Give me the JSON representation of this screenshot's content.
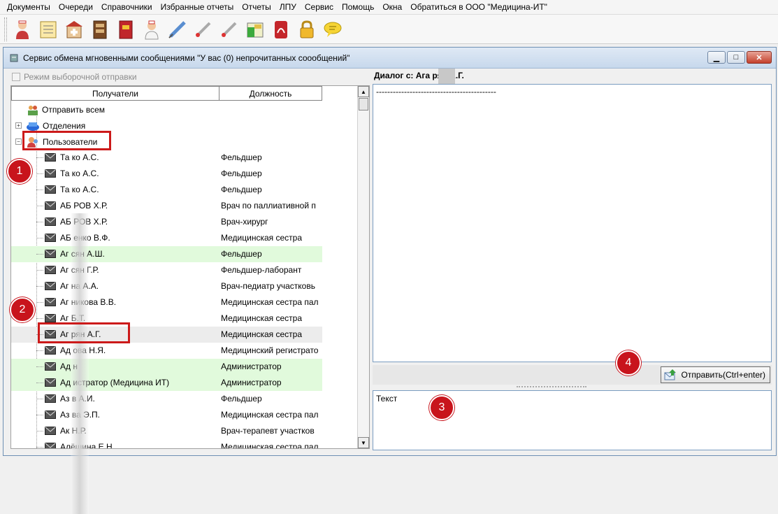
{
  "menu": [
    "Документы",
    "Очереди",
    "Справочники",
    "Избранные отчеты",
    "Отчеты",
    "ЛПУ",
    "Сервис",
    "Помощь",
    "Окна",
    "Обратиться в ООО \"Медицина-ИТ\""
  ],
  "toolbar_icons": [
    "doctor-icon",
    "notepad-icon",
    "hospital-icon",
    "cabinet-icon",
    "red-book-icon",
    "nurse-icon",
    "syringe-icon",
    "thermometer-icon",
    "thermometer2-icon",
    "cash-icon",
    "pdf-icon",
    "lock-icon",
    "chat-icon"
  ],
  "window": {
    "title": "Сервис обмена мгновенными сообщениями \"У вас (0) непрочитанных соообщений\"",
    "btn_min": "▁",
    "btn_max": "□",
    "btn_close": "✕"
  },
  "left": {
    "selective_send_label": "Режим выборочной отправки",
    "col_recipients": "Получатели",
    "col_position": "Должность",
    "node_send_all": "Отправить всем",
    "node_departments": "Отделения",
    "node_users": "Пользователи",
    "rows": [
      {
        "name": "Та        ко А.С.",
        "position": "Фельдшер",
        "hl": false
      },
      {
        "name": "Та        ко А.С.",
        "position": "Фельдшер",
        "hl": false
      },
      {
        "name": "Та        ко А.С.",
        "position": "Фельдшер",
        "hl": false
      },
      {
        "name": "АБ        РОВ Х.Р.",
        "position": "Врач по паллиативной п",
        "hl": false
      },
      {
        "name": "АБ        РОВ Х.Р.",
        "position": "Врач-хирург",
        "hl": false
      },
      {
        "name": "АБ        енко В.Ф.",
        "position": "Медицинская сестра",
        "hl": false
      },
      {
        "name": "Аг        сян А.Ш.",
        "position": "Фельдшер",
        "hl": true
      },
      {
        "name": "Аг        сян Г.Р.",
        "position": "Фельдшер-лаборант",
        "hl": false
      },
      {
        "name": "Аг        на А.А.",
        "position": "Врач-педиатр участковь",
        "hl": false
      },
      {
        "name": "Аг        никова В.В.",
        "position": "Медицинская сестра пал",
        "hl": false
      },
      {
        "name": "Аг        Б.Т.",
        "position": "Медицинская сестра",
        "hl": false
      },
      {
        "name": "Аг        рян А.Г.",
        "position": "Медицинская сестра",
        "hl": true,
        "sel": true
      },
      {
        "name": "Ад        ова Н.Я.",
        "position": "Медицинский регистрато",
        "hl": false
      },
      {
        "name": "Ад        н",
        "position": "Администратор",
        "hl": true
      },
      {
        "name": "Ад        истратор (Медицина ИТ)",
        "position": "Администратор",
        "hl": true
      },
      {
        "name": "Аз        в А.И.",
        "position": "Фельдшер",
        "hl": false
      },
      {
        "name": "Аз        ва Э.П.",
        "position": "Медицинская сестра пал",
        "hl": false
      },
      {
        "name": "Ак        Н.Р.",
        "position": "Врач-терапевт участков",
        "hl": false
      },
      {
        "name": "Алёшина Е.Н.",
        "position": "Медицинская сестра пал",
        "hl": false
      }
    ]
  },
  "right": {
    "dialog_label": "Диалог с:  Ага    рян А.Г.",
    "history_text": "-------------------------------------------",
    "send_button": "Отправить(Ctrl+enter)",
    "input_text": "Текст"
  },
  "callouts": [
    "1",
    "2",
    "3",
    "4"
  ],
  "colors": {
    "highlight_row": "#e1fadc",
    "callout": "#c8141c",
    "window_border": "#6d8fb3"
  }
}
